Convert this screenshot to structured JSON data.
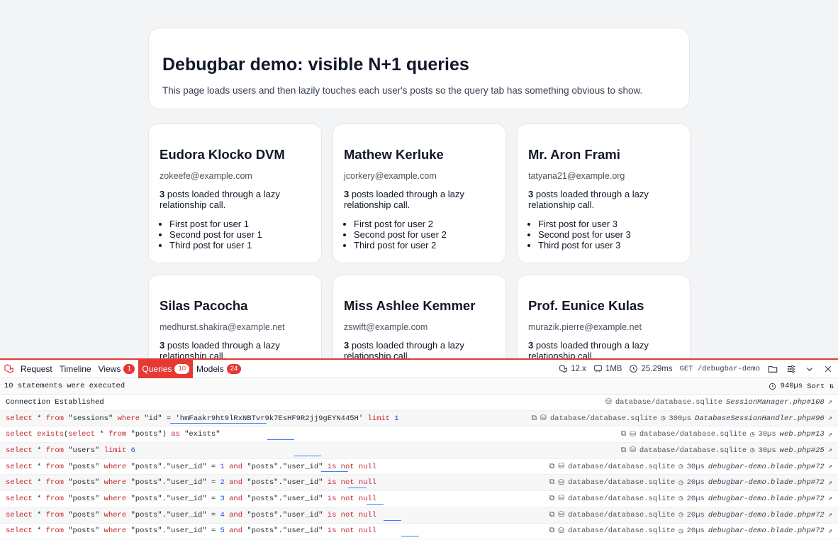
{
  "hero": {
    "title": "Debugbar demo: visible N+1 queries",
    "description": "This page loads users and then lazily touches each user's posts so the query tab has something obvious to show."
  },
  "users": [
    {
      "name": "Eudora Klocko DVM",
      "email": "zokeefe@example.com",
      "count": "3",
      "count_text": " posts loaded through a lazy relationship call.",
      "posts": [
        "First post for user 1",
        "Second post for user 1",
        "Third post for user 1"
      ]
    },
    {
      "name": "Mathew Kerluke",
      "email": "jcorkery@example.com",
      "count": "3",
      "count_text": " posts loaded through a lazy relationship call.",
      "posts": [
        "First post for user 2",
        "Second post for user 2",
        "Third post for user 2"
      ]
    },
    {
      "name": "Mr. Aron Frami",
      "email": "tatyana21@example.org",
      "count": "3",
      "count_text": " posts loaded through a lazy relationship call.",
      "posts": [
        "First post for user 3",
        "Second post for user 3",
        "Third post for user 3"
      ]
    },
    {
      "name": "Silas Pacocha",
      "email": "medhurst.shakira@example.net",
      "count": "3",
      "count_text": " posts loaded through a lazy relationship call."
    },
    {
      "name": "Miss Ashlee Kemmer",
      "email": "zswift@example.com",
      "count": "3",
      "count_text": " posts loaded through a lazy relationship call."
    },
    {
      "name": "Prof. Eunice Kulas",
      "email": "murazik.pierre@example.net",
      "count": "3",
      "count_text": " posts loaded through a lazy relationship call."
    }
  ],
  "debugbar": {
    "tabs": [
      {
        "label": "Request",
        "badge": ""
      },
      {
        "label": "Timeline",
        "badge": ""
      },
      {
        "label": "Views",
        "badge": "1"
      },
      {
        "label": "Queries",
        "badge": "10",
        "active": true
      },
      {
        "label": "Models",
        "badge": "24"
      }
    ],
    "status": {
      "laravel_version": "12.x",
      "memory": "1MB",
      "duration": "25.29ms",
      "request": "GET /debugbar-demo"
    },
    "summary": "10 statements were executed",
    "summary_time": "940µs",
    "sort_label": "Sort",
    "accent_color": "#e53935",
    "connection": {
      "label": "Connection Established",
      "db": "database/database.sqlite",
      "source": "SessionManager.php#108"
    },
    "queries": [
      {
        "sql": "session",
        "db": "database/database.sqlite",
        "time": "300µs",
        "source": "DatabaseSessionHandler.php#96"
      },
      {
        "sql": "exists",
        "db": "database/database.sqlite",
        "time": "30µs",
        "source": "web.php#13"
      },
      {
        "sql": "users",
        "db": "database/database.sqlite",
        "time": "30µs",
        "source": "web.php#25"
      },
      {
        "sql": "posts",
        "user_id": "1",
        "db": "database/database.sqlite",
        "time": "30µs",
        "source": "debugbar-demo.blade.php#72"
      },
      {
        "sql": "posts",
        "user_id": "2",
        "db": "database/database.sqlite",
        "time": "20µs",
        "source": "debugbar-demo.blade.php#72"
      },
      {
        "sql": "posts",
        "user_id": "3",
        "db": "database/database.sqlite",
        "time": "20µs",
        "source": "debugbar-demo.blade.php#72"
      },
      {
        "sql": "posts",
        "user_id": "4",
        "db": "database/database.sqlite",
        "time": "20µs",
        "source": "debugbar-demo.blade.php#72"
      },
      {
        "sql": "posts",
        "user_id": "5",
        "db": "database/database.sqlite",
        "time": "20µs",
        "source": "debugbar-demo.blade.php#72"
      }
    ],
    "session_id": "'hmFaakr9ht9lRxNBTvr9k7EsHF9R2jj9gEYN445H'",
    "users_limit": "6"
  }
}
